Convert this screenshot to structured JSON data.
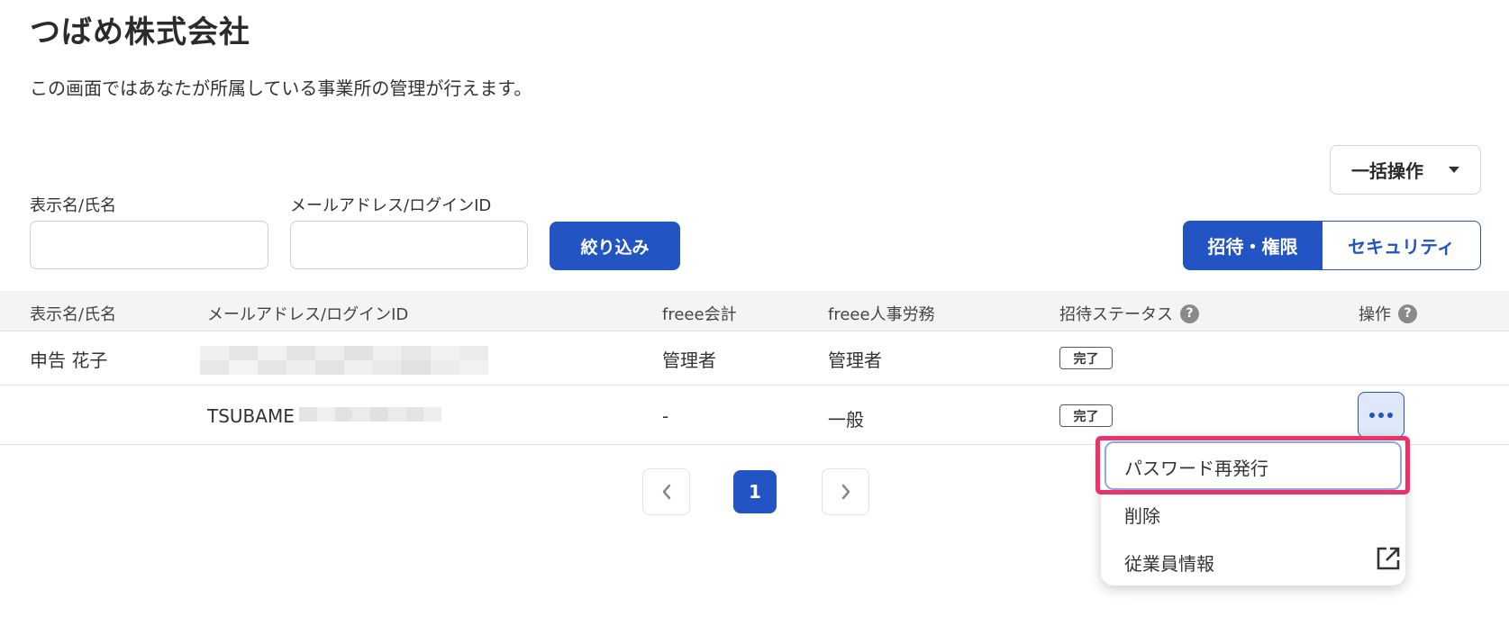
{
  "page": {
    "title": "つばめ株式会社",
    "description": "この画面ではあなたが所属している事業所の管理が行えます。"
  },
  "bulk_action": {
    "label": "一括操作",
    "icon": "chevron-down-icon"
  },
  "filters": {
    "name_label": "表示名/氏名",
    "name_value": "",
    "email_label": "メールアドレス/ログインID",
    "email_value": "",
    "button_label": "絞り込み"
  },
  "tabs": [
    {
      "label": "招待・権限",
      "active": true
    },
    {
      "label": "セキュリティ",
      "active": false
    }
  ],
  "table": {
    "headers": {
      "name": "表示名/氏名",
      "email": "メールアドレス/ログインID",
      "accounting": "freee会計",
      "hr": "freee人事労務",
      "invite_status": "招待ステータス",
      "actions": "操作"
    },
    "help_icon": "question-circle-icon",
    "rows": [
      {
        "name": "申告 花子",
        "email": "",
        "accounting": "管理者",
        "hr": "管理者",
        "status": "完了"
      },
      {
        "name": "",
        "email": "TSUBAME",
        "accounting": "-",
        "hr": "一般",
        "status": "完了"
      }
    ]
  },
  "pagination": {
    "prev_icon": "chevron-left-icon",
    "current": "1",
    "next_icon": "chevron-right-icon"
  },
  "row_menu": {
    "trigger_icon": "more-horizontal-icon",
    "items": [
      {
        "label": "パスワード再発行"
      },
      {
        "label": "削除"
      },
      {
        "label": "従業員情報",
        "icon": "external-link-icon"
      }
    ]
  },
  "colors": {
    "primary": "#2254c4",
    "highlight": "#e8336b",
    "header_bg": "#f5f4f2"
  }
}
